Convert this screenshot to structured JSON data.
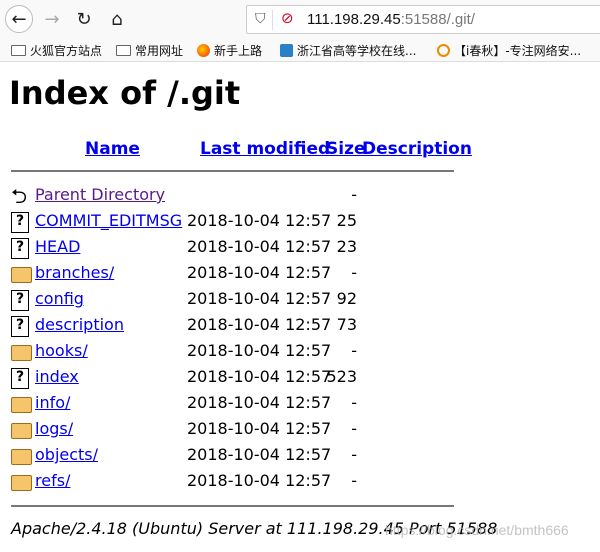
{
  "browser": {
    "url_host": "111.198.29.45",
    "url_rest": ":51588/.git/",
    "bookmarks": [
      "火狐官方站点",
      "常用网址",
      "新手上路",
      "浙江省高等学校在线...",
      "【i春秋】-专注网络安..."
    ]
  },
  "page": {
    "title": "Index of /.git",
    "headers": {
      "name": "Name",
      "modified": "Last modified",
      "size": "Size",
      "description": "Description"
    },
    "rows": [
      {
        "icon": "parent",
        "name": "Parent Directory",
        "date": "",
        "size": "-"
      },
      {
        "icon": "file",
        "name": "COMMIT_EDITMSG",
        "date": "2018-10-04 12:57",
        "size": "25"
      },
      {
        "icon": "file",
        "name": "HEAD",
        "date": "2018-10-04 12:57",
        "size": "23"
      },
      {
        "icon": "dir",
        "name": "branches/",
        "date": "2018-10-04 12:57",
        "size": "-"
      },
      {
        "icon": "file",
        "name": "config",
        "date": "2018-10-04 12:57",
        "size": "92"
      },
      {
        "icon": "file",
        "name": "description",
        "date": "2018-10-04 12:57",
        "size": "73"
      },
      {
        "icon": "dir",
        "name": "hooks/",
        "date": "2018-10-04 12:57",
        "size": "-"
      },
      {
        "icon": "file",
        "name": "index",
        "date": "2018-10-04 12:57",
        "size": "523"
      },
      {
        "icon": "dir",
        "name": "info/",
        "date": "2018-10-04 12:57",
        "size": "-"
      },
      {
        "icon": "dir",
        "name": "logs/",
        "date": "2018-10-04 12:57",
        "size": "-"
      },
      {
        "icon": "dir",
        "name": "objects/",
        "date": "2018-10-04 12:57",
        "size": "-"
      },
      {
        "icon": "dir",
        "name": "refs/",
        "date": "2018-10-04 12:57",
        "size": "-"
      }
    ],
    "footer": "Apache/2.4.18 (Ubuntu) Server at 111.198.29.45 Port 51588",
    "watermark": "https://blog.csdn.net/bmth666"
  }
}
